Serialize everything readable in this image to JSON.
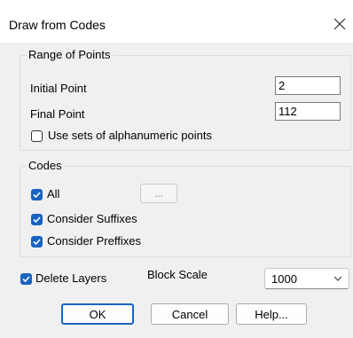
{
  "window": {
    "title": "Draw from Codes"
  },
  "range_group": {
    "legend": "Range of Points",
    "initial_label": "Initial Point",
    "initial_value": "2",
    "final_label": "Final Point",
    "final_value": "112",
    "alpha_label": "Use sets of alphanumeric points",
    "alpha_checked": false
  },
  "codes_group": {
    "legend": "Codes",
    "all_label": "All",
    "all_checked": true,
    "browse_label": "...",
    "suffix_label": "Consider Suffixes",
    "suffix_checked": true,
    "prefix_label": "Consider Preffixes",
    "prefix_checked": true
  },
  "delete_layers": {
    "label": "Delete Layers",
    "checked": true
  },
  "block_scale": {
    "label": "Block Scale",
    "value": "1000"
  },
  "buttons": {
    "ok": "OK",
    "cancel": "Cancel",
    "help": "Help..."
  },
  "icons": {
    "close": "close-icon",
    "check": "checkmark-icon",
    "dropdown": "chevron-down-icon"
  },
  "colors": {
    "accent": "#1a63bf",
    "title_bg": "#ffffff",
    "dialog_bg": "#f0f0f0"
  }
}
